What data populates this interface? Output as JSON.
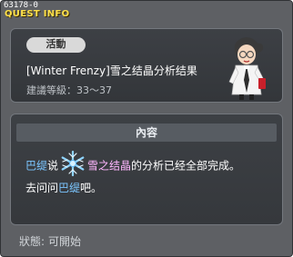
{
  "window": {
    "quest_id": "63178-0",
    "title": "QUEST INFO"
  },
  "header": {
    "category": "活動",
    "quest_title": "[Winter Frenzy]雪之结晶分析结果",
    "level_label": "建議等級：",
    "level_range": "33～37",
    "npc_icon": "scientist-npc-icon"
  },
  "content": {
    "section_title": "內容",
    "npc_name_1": "巴缇",
    "text_1": "说",
    "item_icon": "snowflake-crystal-icon",
    "item_name": "雪之结晶",
    "text_2": "的分析已经全部完成。",
    "text_3": "去问问",
    "npc_name_2": "巴缇",
    "text_4": "吧。"
  },
  "status": {
    "label": "狀態:",
    "value": "可開始"
  },
  "colors": {
    "title": "#ffe14a",
    "npc_name": "#7cc6ff",
    "item_name": "#ffb7ff",
    "panel_bg": "#3d4045",
    "window_bg": "#5e6064"
  }
}
